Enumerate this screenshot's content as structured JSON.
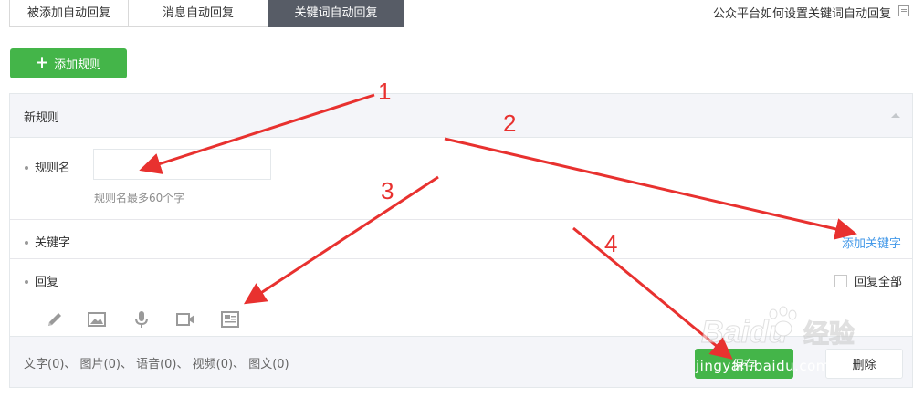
{
  "tabs": [
    {
      "label": "被添加自动回复",
      "active": false
    },
    {
      "label": "消息自动回复",
      "active": false
    },
    {
      "label": "关键词自动回复",
      "active": true
    }
  ],
  "help_link": "公众平台如何设置关键词自动回复",
  "add_rule_button": {
    "icon": "plus",
    "label": "添加规则"
  },
  "rule_panel": {
    "title": "新规则",
    "rule_name": {
      "label": "规则名",
      "value": "",
      "hint": "规则名最多60个字"
    },
    "keyword": {
      "label": "关键字",
      "add_link": "添加关键字"
    },
    "reply": {
      "label": "回复",
      "reply_all_label": "回复全部",
      "reply_all_checked": false
    },
    "tool_icons": [
      "pencil-icon",
      "image-icon",
      "microphone-icon",
      "video-icon",
      "article-icon"
    ],
    "counts_text": "文字(0)、 图片(0)、 语音(0)、 视频(0)、 图文(0)",
    "save_label": "保存",
    "delete_label": "删除"
  },
  "annotations": {
    "numbers": [
      "1",
      "2",
      "3",
      "4"
    ],
    "color": "#e8312f"
  },
  "watermark": {
    "brand": "Baidu",
    "cn": "经验",
    "url": "jingyan.baidu.com"
  },
  "colors": {
    "accent": "#44b549",
    "tab_active": "#575c66",
    "link": "#459ae9",
    "panel_bg": "#f4f5f9"
  }
}
